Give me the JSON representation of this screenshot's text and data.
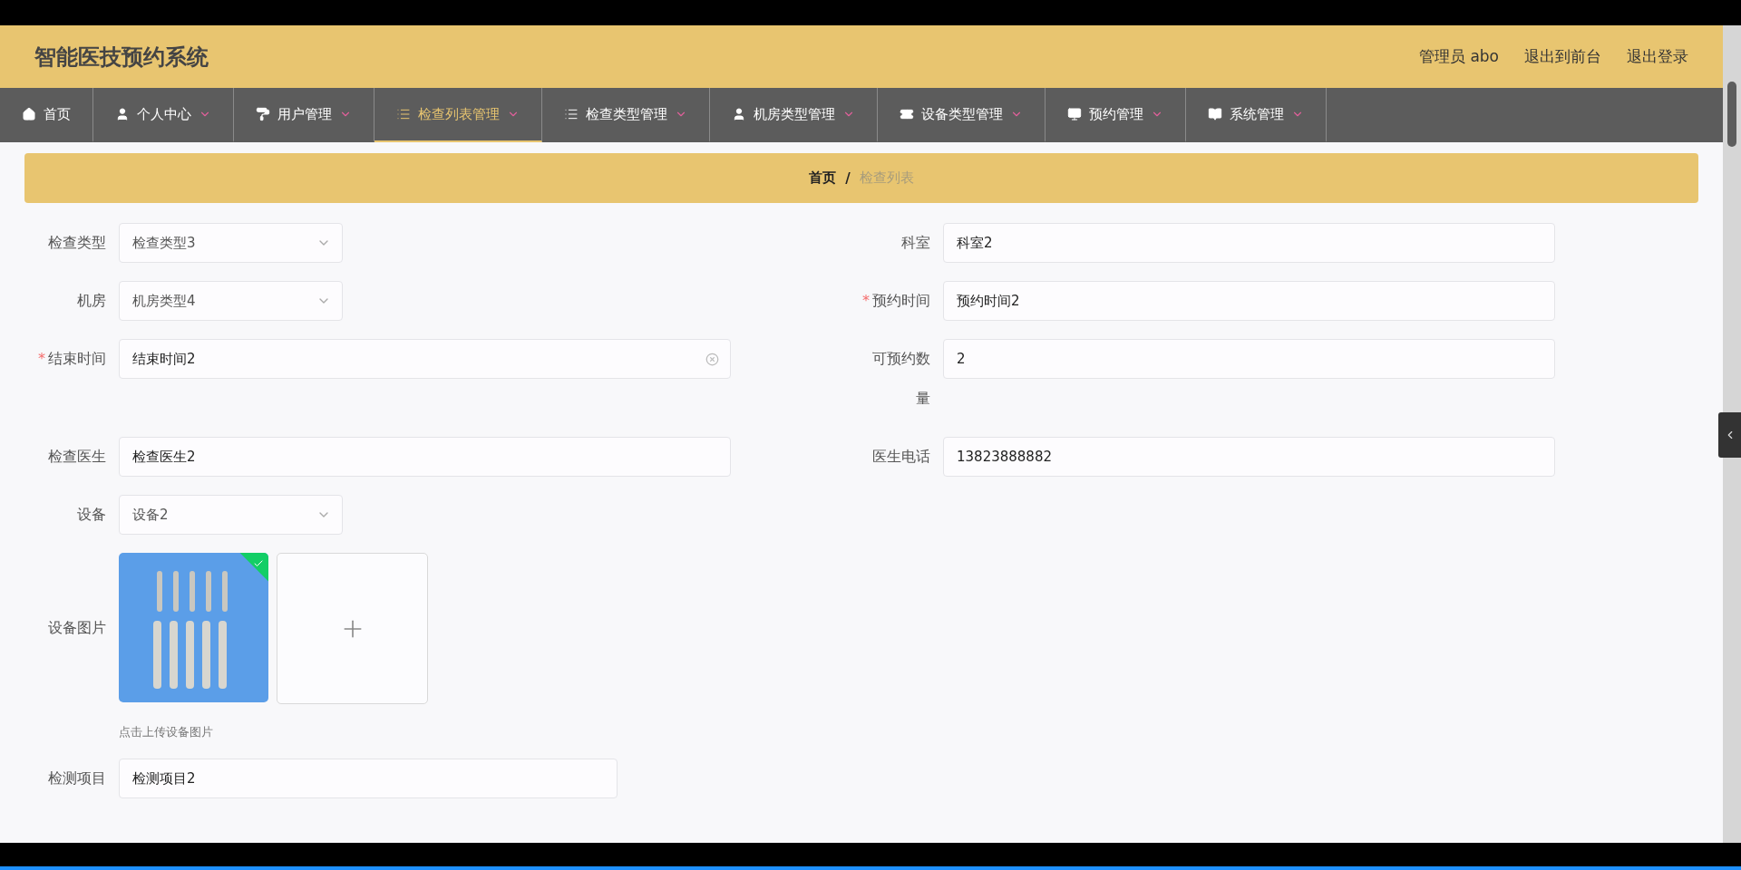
{
  "header": {
    "title": "智能医技预约系统",
    "links": [
      "管理员 abo",
      "退出到前台",
      "退出登录"
    ]
  },
  "nav": [
    {
      "label": "首页",
      "dropdown": false,
      "selected": false
    },
    {
      "label": "个人中心",
      "dropdown": true,
      "selected": false
    },
    {
      "label": "用户管理",
      "dropdown": true,
      "selected": false
    },
    {
      "label": "检查列表管理",
      "dropdown": true,
      "selected": true
    },
    {
      "label": "检查类型管理",
      "dropdown": true,
      "selected": false
    },
    {
      "label": "机房类型管理",
      "dropdown": true,
      "selected": false
    },
    {
      "label": "设备类型管理",
      "dropdown": true,
      "selected": false
    },
    {
      "label": "预约管理",
      "dropdown": true,
      "selected": false
    },
    {
      "label": "系统管理",
      "dropdown": true,
      "selected": false
    }
  ],
  "breadcrumb": [
    "首页",
    "/",
    "检查列表"
  ],
  "form": [
    [
      {
        "label": "检查类型",
        "kind": "select",
        "value": "检查类型3"
      },
      {
        "label": "科室",
        "kind": "input",
        "value": "科室2"
      }
    ],
    [
      {
        "label": "机房",
        "kind": "select",
        "value": "机房类型4"
      },
      {
        "label": "预约时间",
        "required_mark": "*",
        "kind": "input",
        "value": "预约时间2"
      }
    ],
    [
      {
        "label": "结束时间",
        "required_mark": "*",
        "kind": "input",
        "value": "结束时间2",
        "clearable": true
      },
      {
        "label": "可预约数量",
        "kind": "input",
        "value": "2"
      }
    ],
    [
      {
        "label": "检查医生",
        "kind": "input",
        "value": "检查医生2"
      },
      {
        "label": "医生电话",
        "kind": "input",
        "value": "13823888882"
      }
    ],
    [
      {
        "label": "设备",
        "kind": "select",
        "value": "设备2"
      }
    ]
  ],
  "upload": {
    "label": "设备图片",
    "images": [
      {
        "kind": "picture",
        "uploaded": true
      }
    ],
    "hint": "点击上传设备图片"
  },
  "last_field": {
    "label": "检测项目",
    "value": "检测项目2"
  }
}
